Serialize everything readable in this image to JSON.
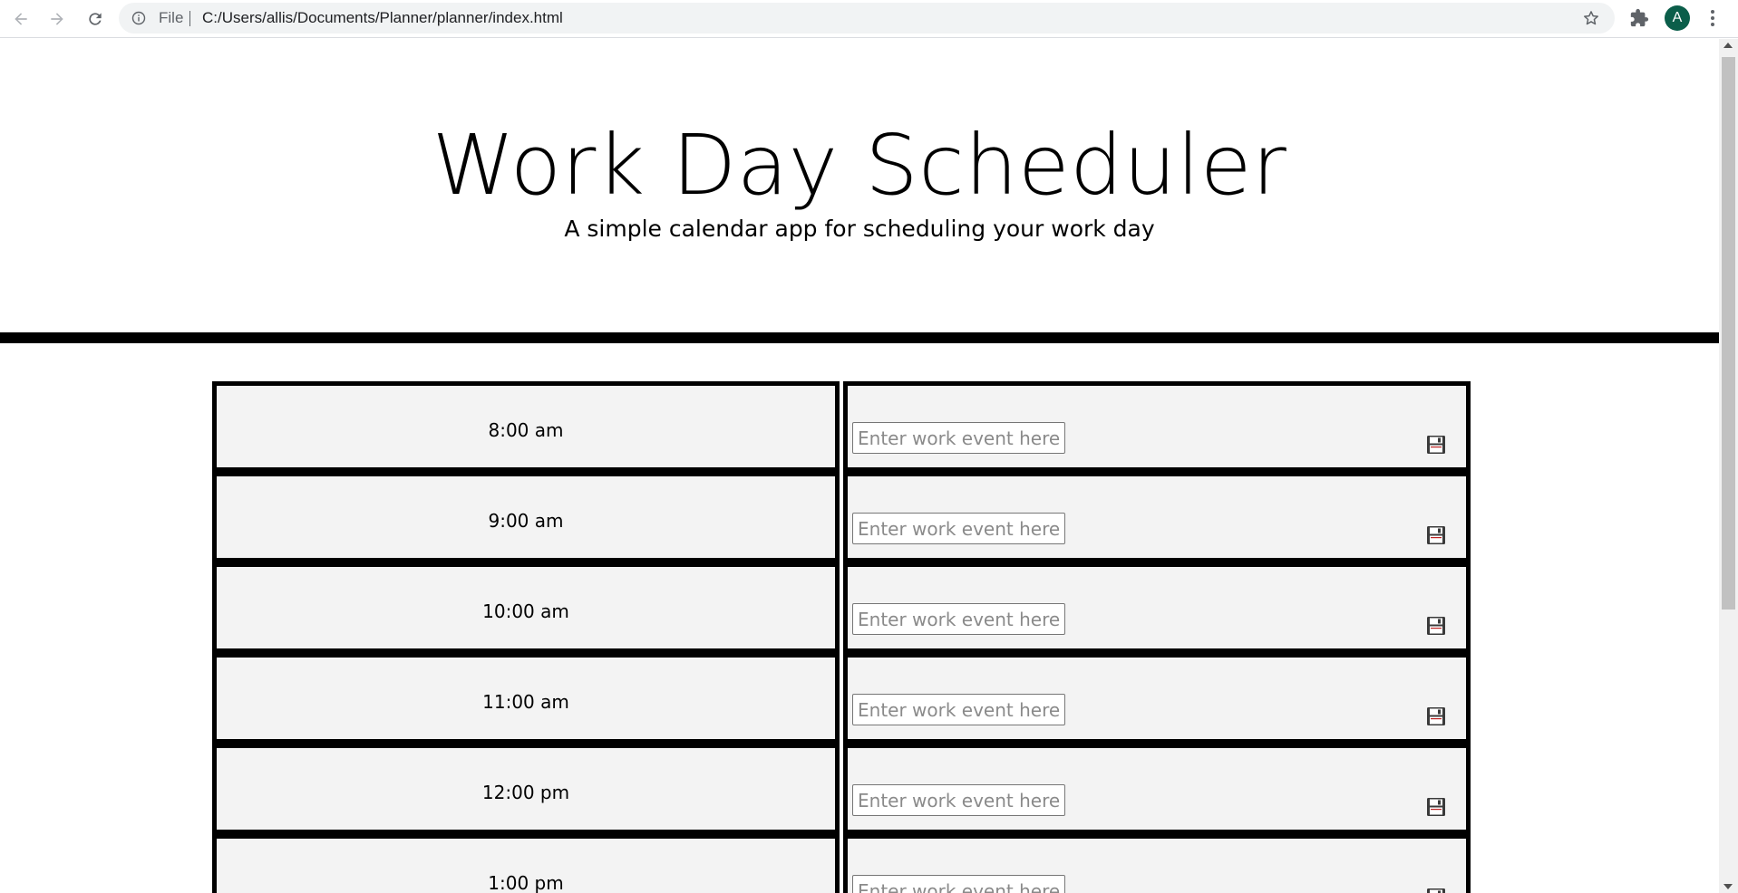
{
  "browser": {
    "file_label": "File",
    "url": "C:/Users/allis/Documents/Planner/planner/index.html",
    "avatar_letter": "A",
    "icons": [
      "back-icon",
      "forward-icon",
      "reload-icon",
      "info-icon",
      "star-icon",
      "extensions-icon",
      "menu-icon"
    ]
  },
  "header": {
    "title": "Work Day Scheduler",
    "subtitle": "A simple calendar app for scheduling your work day"
  },
  "schedule": {
    "placeholder": "Enter work event here",
    "save_icon": "floppy-disk-icon",
    "rows": [
      {
        "hour": "8:00 am",
        "event": ""
      },
      {
        "hour": "9:00 am",
        "event": ""
      },
      {
        "hour": "10:00 am",
        "event": ""
      },
      {
        "hour": "11:00 am",
        "event": ""
      },
      {
        "hour": "12:00 pm",
        "event": ""
      },
      {
        "hour": "1:00 pm",
        "event": ""
      }
    ]
  },
  "colors": {
    "row_background": "#f3f3f3",
    "border": "#000000",
    "avatar": "#0b5e4a"
  }
}
